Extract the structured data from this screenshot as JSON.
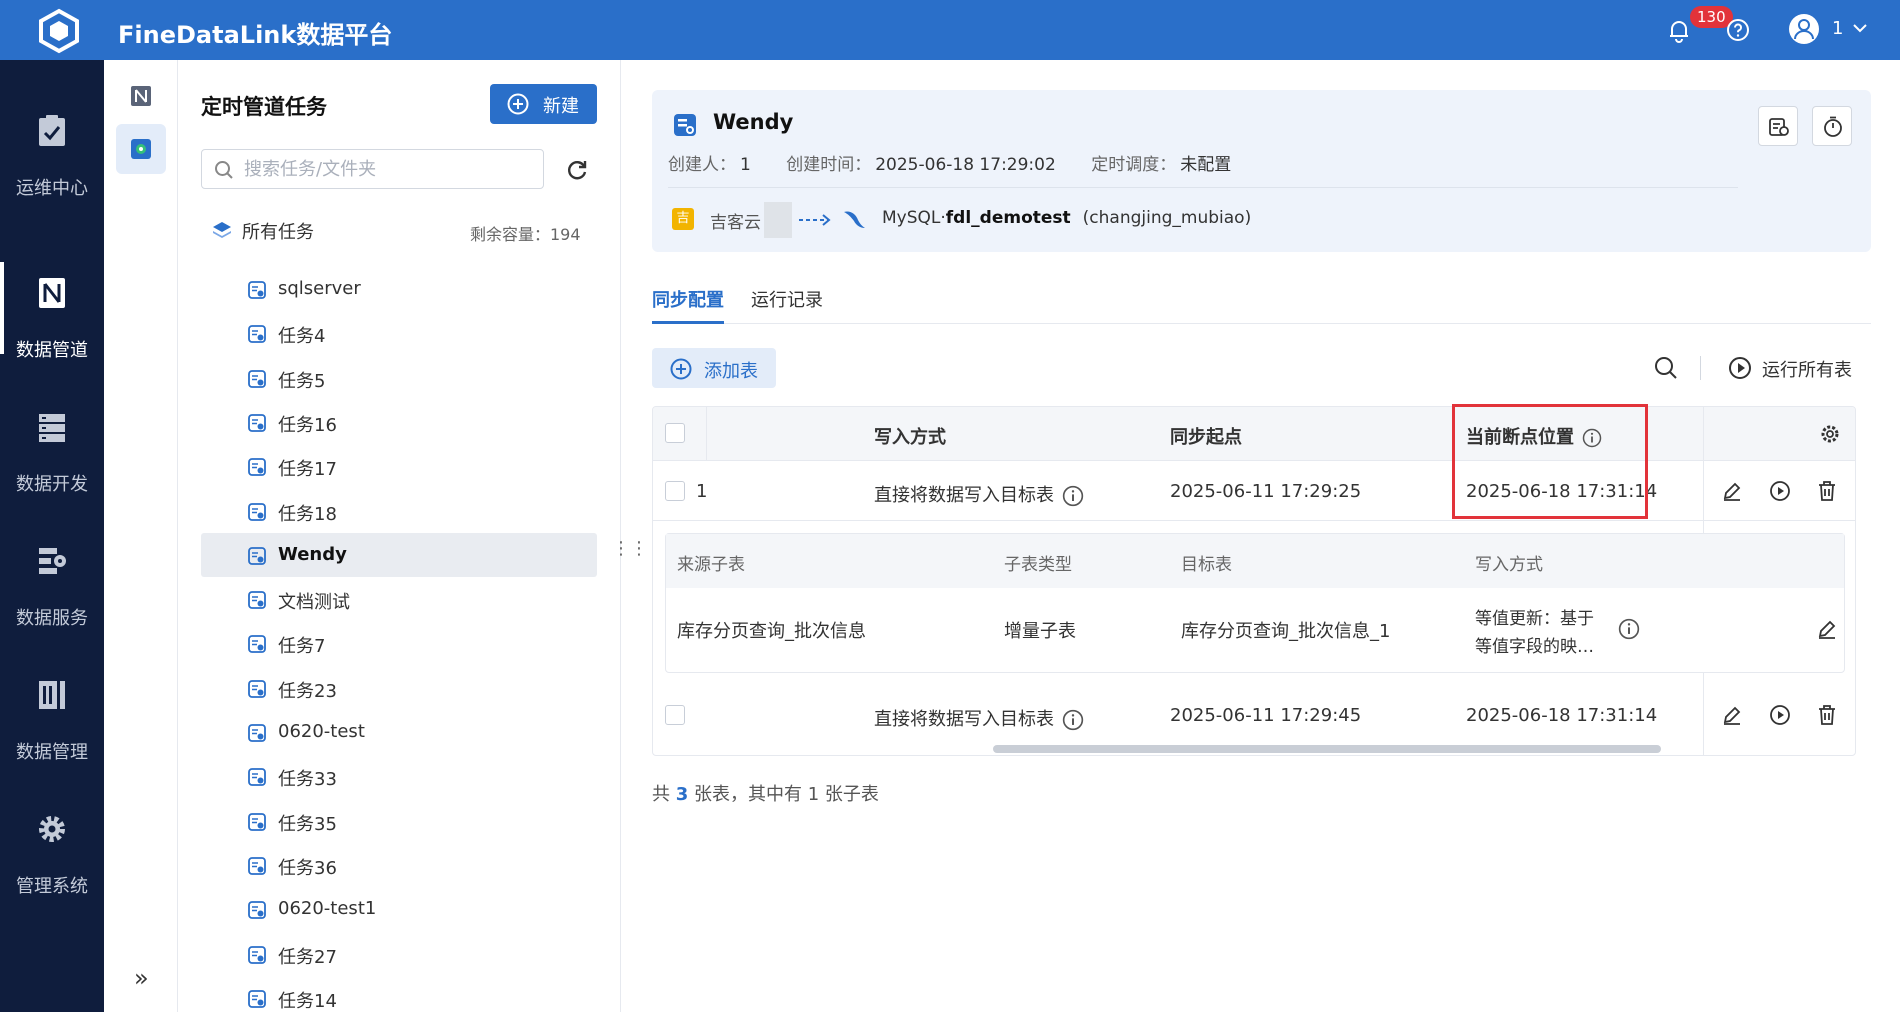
{
  "app": {
    "title": "FineDataLink数据平台",
    "notification_count": "130",
    "user": "1"
  },
  "nav": {
    "items": [
      {
        "label": "运维中心",
        "icon": "clipboard-icon"
      },
      {
        "label": "数据管道",
        "icon": "pipeline-icon",
        "active": true
      },
      {
        "label": "数据开发",
        "icon": "database-dev-icon"
      },
      {
        "label": "数据服务",
        "icon": "service-icon"
      },
      {
        "label": "数据管理",
        "icon": "data-manage-icon"
      },
      {
        "label": "管理系统",
        "icon": "gear-icon"
      }
    ]
  },
  "panel": {
    "title": "定时管道任务",
    "new_button": "新建",
    "search_placeholder": "搜索任务/文件夹",
    "all_tasks": "所有任务",
    "capacity": "剩余容量：194",
    "tasks": [
      "sqlserver",
      "任务4",
      "任务5",
      "任务16",
      "任务17",
      "任务18",
      "Wendy",
      "文档测试",
      "任务7",
      "任务23",
      "0620-test",
      "任务33",
      "任务35",
      "任务36",
      "0620-test1",
      "任务27",
      "任务14"
    ],
    "selected": "Wendy"
  },
  "task": {
    "name": "Wendy",
    "creator_label": "创建人：",
    "creator": "1",
    "created_label": "创建时间：",
    "created": "2025-06-18 17:29:02",
    "schedule_label": "定时调度：",
    "schedule": "未配置",
    "source": "吉客云",
    "dest_prefix": "MySQL·",
    "dest_db": "fdl_demotest",
    "dest_schema": "(changjing_mubiao)"
  },
  "tabs": [
    "同步配置",
    "运行记录"
  ],
  "toolbar": {
    "add_table": "添加表",
    "run_all": "运行所有表"
  },
  "table": {
    "headers": {
      "write_mode": "写入方式",
      "sync_start": "同步起点",
      "breakpoint": "当前断点位置"
    },
    "rows": [
      {
        "name": "1",
        "write_mode": "直接将数据写入目标表",
        "sync_start": "2025-06-11 17:29:25",
        "breakpoint": "2025-06-18 17:31:14"
      },
      {
        "name": "",
        "write_mode": "直接将数据写入目标表",
        "sync_start": "2025-06-11 17:29:45",
        "breakpoint": "2025-06-18 17:31:14"
      }
    ],
    "sub": {
      "headers": {
        "source": "来源子表",
        "type": "子表类型",
        "target": "目标表",
        "mode": "写入方式"
      },
      "row": {
        "source": "库存分页查询_批次信息",
        "type": "增量子表",
        "target": "库存分页查询_批次信息_1",
        "mode_line1": "等值更新：基于",
        "mode_line2": "等值字段的映…"
      }
    }
  },
  "footer": {
    "prefix": "共 ",
    "tables": "3",
    "mid": " 张表，其中有 ",
    "subs": "1",
    "suffix": " 张子表"
  },
  "colors": {
    "brand": "#2a6fc9",
    "nav_bg": "#0f1d3d",
    "highlight": "#e2333a"
  }
}
